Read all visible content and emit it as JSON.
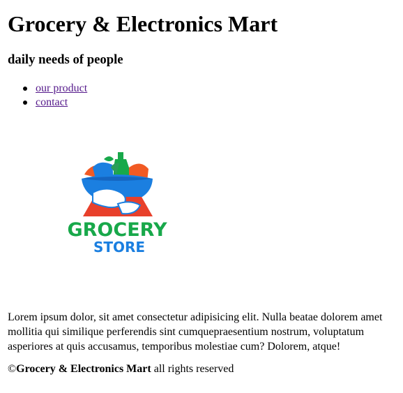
{
  "header": {
    "title": "Grocery & Electronics Mart",
    "tagline": "daily needs of people"
  },
  "nav": {
    "items": [
      {
        "label": "our product"
      },
      {
        "label": "contact"
      }
    ]
  },
  "logo": {
    "line1": "GROCERY",
    "line2": "STORE",
    "colors": {
      "green": "#18a84a",
      "blue": "#1b7fe0",
      "orange": "#f15a24",
      "red": "#e8402b"
    }
  },
  "main": {
    "paragraph": "Lorem ipsum dolor, sit amet consectetur adipisicing elit. Nulla beatae dolorem amet mollitia qui similique perferendis sint cumquepraesentium nostrum, voluptatum asperiores at quis accusamus, temporibus molestiae cum? Dolorem, atque!"
  },
  "footer": {
    "copyright_symbol": "©",
    "brand": "Grocery & Electronics Mart",
    "suffix": " all rights reserved"
  }
}
